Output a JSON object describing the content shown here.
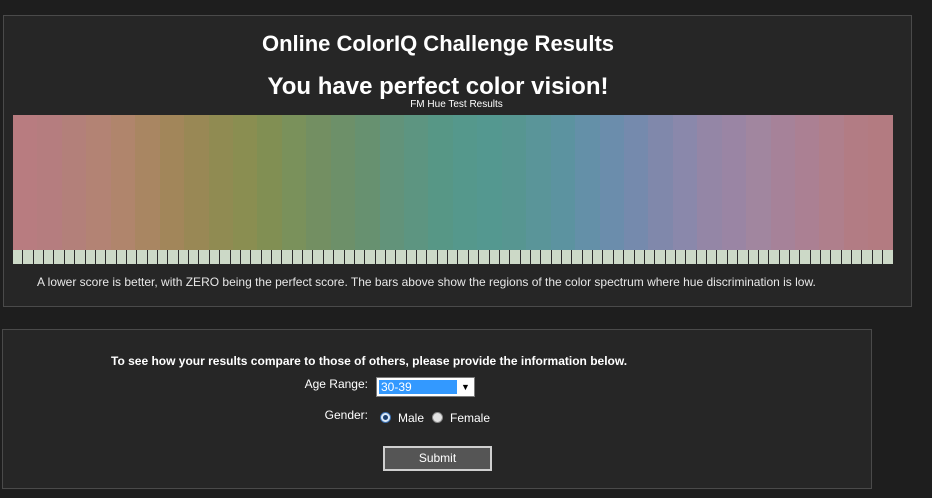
{
  "results": {
    "title": "Online ColorIQ Challenge Results",
    "headline": "You have perfect color vision!",
    "chart_title": "FM Hue Test Results",
    "explanation": "A lower score is better, with ZERO being the perfect score. The bars above show the regions of the color spectrum where hue discrimination is low.",
    "score_cells": 85,
    "hue_colors": [
      "#b87c80",
      "#b57d7f",
      "#b3807a",
      "#b38374",
      "#b0856c",
      "#a98662",
      "#a2865a",
      "#998855",
      "#908b52",
      "#8a8e51",
      "#818f53",
      "#7a915b",
      "#738f62",
      "#6d9069",
      "#679170",
      "#62937a",
      "#5d9581",
      "#579786",
      "#55988c",
      "#549890",
      "#579691",
      "#5a9599",
      "#5c93a0",
      "#6490a8",
      "#6b8dac",
      "#758aad",
      "#8088ab",
      "#8a88ab",
      "#9486a6",
      "#9a85a4",
      "#a1869f",
      "#a68299",
      "#ab8093",
      "#af7f8c",
      "#b27c84",
      "#b37b81"
    ]
  },
  "form": {
    "prompt": "To see how your results compare to those of others, please provide the information below.",
    "age_label": "Age Range:",
    "age_value": "30-39",
    "age_arrow": "▼",
    "gender_label": "Gender:",
    "gender_options": [
      "Male",
      "Female"
    ],
    "gender_selected": "Male",
    "submit_label": "Submit"
  }
}
